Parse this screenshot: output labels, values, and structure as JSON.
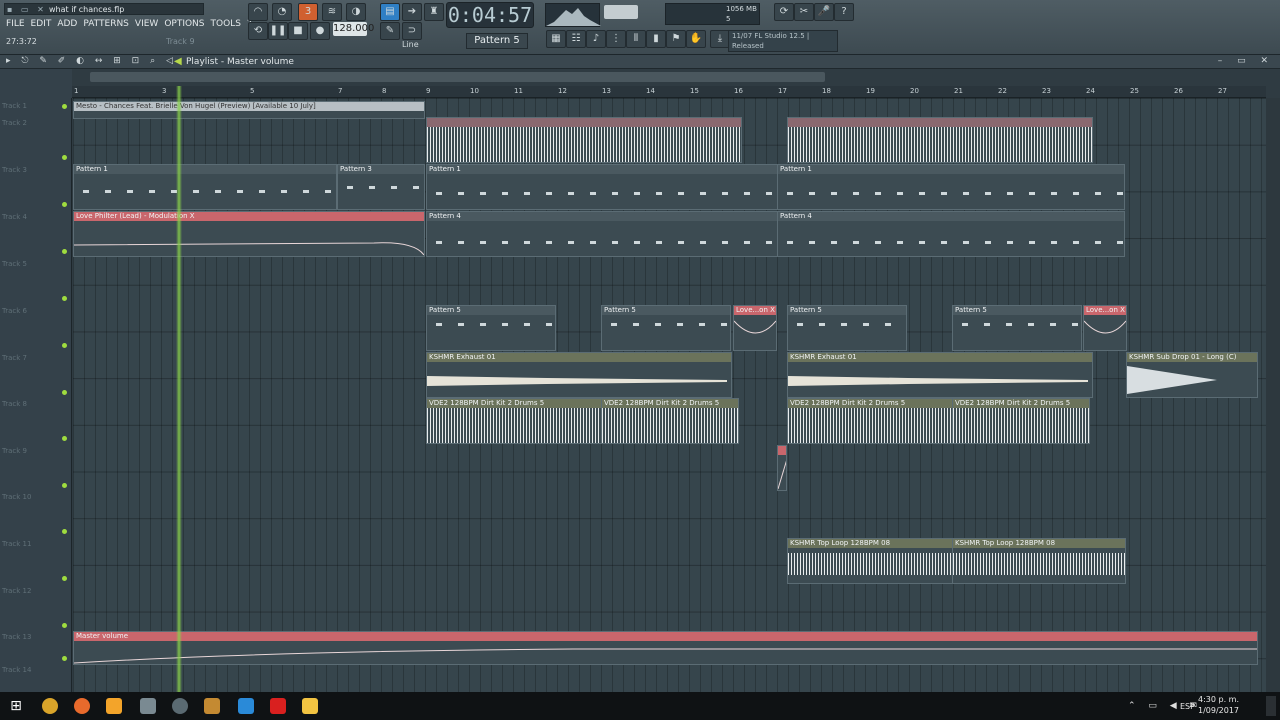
{
  "window": {
    "title": "what if chances.flp",
    "hint_value": "27:3:72",
    "hint_track": "Track 9"
  },
  "menu": [
    "FILE",
    "EDIT",
    "ADD",
    "PATTERNS",
    "VIEW",
    "OPTIONS",
    "TOOLS",
    "?"
  ],
  "transport": {
    "time": "0:04:57",
    "tempo": "128.000",
    "pattern": "Pattern 5",
    "snap": "Line"
  },
  "hint_panel": {
    "line1": "11/07 FL Studio 12.5 |",
    "line2": "Released"
  },
  "cpu": {
    "line1": "1056 MB",
    "line2": "5"
  },
  "playlist": {
    "title": "Playlist - Master volume"
  },
  "ruler": [
    "1",
    "3",
    "5",
    "7",
    "8",
    "9",
    "10",
    "11",
    "12",
    "13",
    "14",
    "15",
    "16",
    "17",
    "18",
    "19",
    "20",
    "21",
    "22",
    "23",
    "24",
    "25",
    "26",
    "27"
  ],
  "tracks": [
    "Track 1",
    "Track 2",
    "Track 3",
    "Track 4",
    "Track 5",
    "Track 6",
    "Track 7",
    "Track 8",
    "Track 9",
    "Track 10",
    "Track 11",
    "Track 12",
    "Track 13",
    "Track 14"
  ],
  "clips": {
    "c1": "Mesto - Chances Feat. Brielle Von Hugel (Preview) [Available 10 July]",
    "p1a": "Pattern 1",
    "p3": "Pattern 3",
    "p1b": "Pattern 1",
    "p1c": "Pattern 1",
    "lead": "Love Philter (Lead) - Modulation X",
    "p4a": "Pattern 4",
    "p4b": "Pattern 4",
    "p5a": "Pattern 5",
    "p5b": "Pattern 5",
    "love1": "Love...on X",
    "p5c": "Pattern 5",
    "p5d": "Pattern 5",
    "love2": "Love...on X",
    "ex1": "KSHMR Exhaust 01",
    "ex2": "KSHMR Exhaust 01",
    "sub": "KSHMR Sub Drop 01 - Long (C)",
    "vd1": "VDE2 128BPM Dirt Kit 2 Drums 5",
    "vd2": "VDE2 128BPM Dirt Kit 2 Drums 5",
    "vd3": "VDE2 128BPM Dirt Kit 2 Drums 5",
    "vd4": "VDE2 128BPM Dirt Kit 2 Drums 5",
    "tl1": "KSHMR Top Loop 128BPM 08",
    "tl2": "KSHMR Top Loop 128BPM 08",
    "master": "Master volume"
  },
  "taskbar": {
    "time": "4:30 p. m.",
    "date": "1/09/2017",
    "lang": "ESP"
  }
}
